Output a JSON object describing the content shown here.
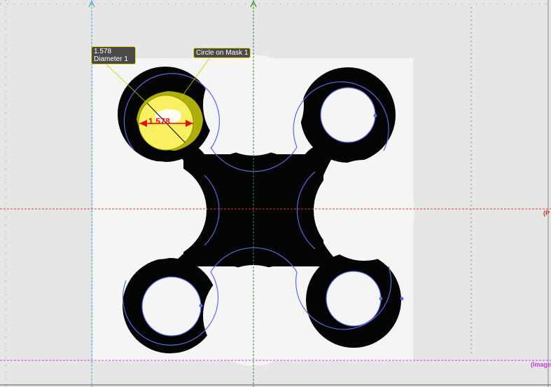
{
  "measurement": {
    "diameter_value": "1.578",
    "diameter_name": "Diameter 1",
    "circle_label": "Circle on Mask 1",
    "dimension_text": "1.578"
  },
  "axes": {
    "p_label": "(P",
    "image_label": "(Image"
  },
  "colors": {
    "background": "#e6e6e6",
    "paper": "#f5f5f5",
    "part": "#050505",
    "edge_outline": "#5a6ad8",
    "highlight": "#f8f060",
    "dimension": "#e01010",
    "cyan_axis": "#3aa8c8",
    "green_axis": "#2a8a2a",
    "red_axis": "#d04020",
    "magenta_axis": "#c040d8"
  }
}
